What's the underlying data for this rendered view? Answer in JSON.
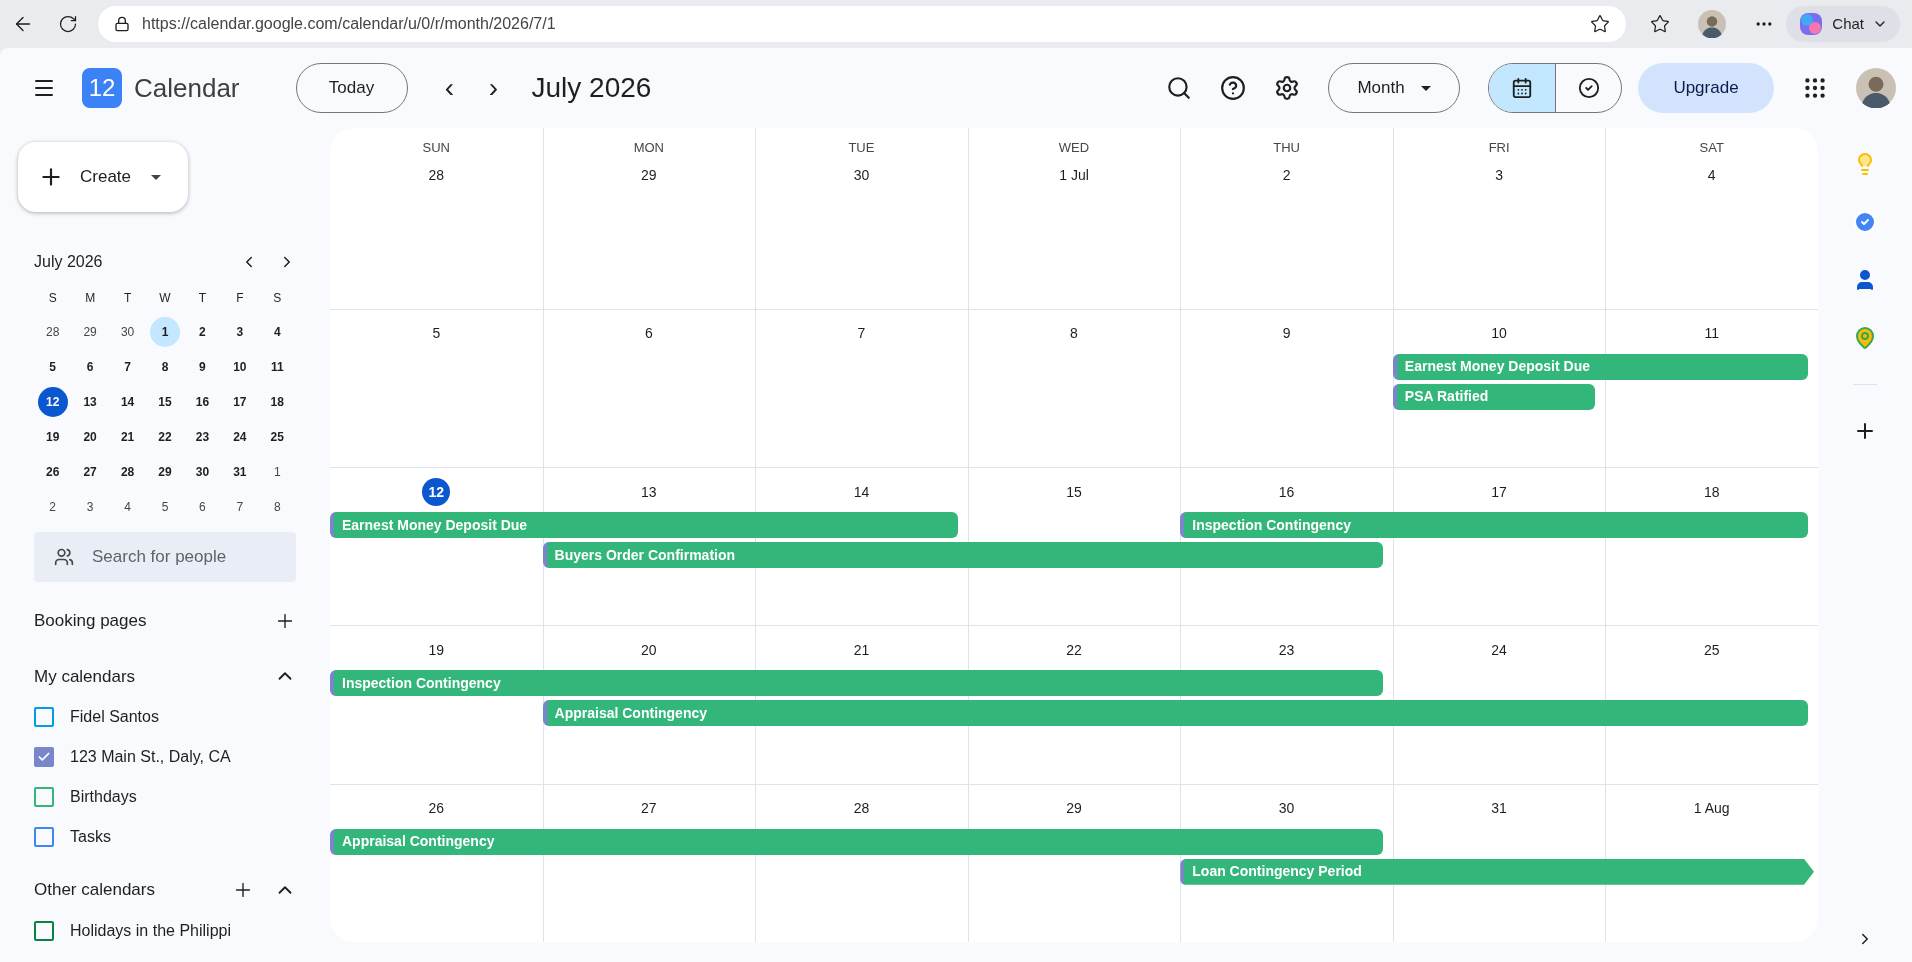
{
  "browser": {
    "url": "https://calendar.google.com/calendar/u/0/r/month/2026/7/1",
    "chat_label": "Chat"
  },
  "header": {
    "logo_day": "12",
    "app_name": "Calendar",
    "today_button": "Today",
    "prev_icon": "‹",
    "next_icon": "›",
    "title": "July 2026",
    "view_dropdown": "Month",
    "view_toggle": [
      {
        "kind": "calendar",
        "selected": true
      },
      {
        "kind": "tasks",
        "selected": false
      }
    ],
    "upgrade_button": "Upgrade"
  },
  "sidebar": {
    "create_button": "Create",
    "mini_calendar": {
      "title": "July 2026",
      "weekdays": [
        "S",
        "M",
        "T",
        "W",
        "T",
        "F",
        "S"
      ],
      "weeks": [
        [
          {
            "d": "28",
            "muted": true,
            "today": false,
            "selected": false
          },
          {
            "d": "29",
            "muted": true,
            "today": false,
            "selected": false
          },
          {
            "d": "30",
            "muted": true,
            "today": false,
            "selected": false
          },
          {
            "d": "1",
            "muted": false,
            "today": false,
            "selected": true
          },
          {
            "d": "2",
            "muted": false,
            "today": false,
            "selected": false
          },
          {
            "d": "3",
            "muted": false,
            "today": false,
            "selected": false
          },
          {
            "d": "4",
            "muted": false,
            "today": false,
            "selected": false
          }
        ],
        [
          {
            "d": "5",
            "muted": false,
            "today": false,
            "selected": false
          },
          {
            "d": "6",
            "muted": false,
            "today": false,
            "selected": false
          },
          {
            "d": "7",
            "muted": false,
            "today": false,
            "selected": false
          },
          {
            "d": "8",
            "muted": false,
            "today": false,
            "selected": false
          },
          {
            "d": "9",
            "muted": false,
            "today": false,
            "selected": false
          },
          {
            "d": "10",
            "muted": false,
            "today": false,
            "selected": false
          },
          {
            "d": "11",
            "muted": false,
            "today": false,
            "selected": false
          }
        ],
        [
          {
            "d": "12",
            "muted": false,
            "today": true,
            "selected": false
          },
          {
            "d": "13",
            "muted": false,
            "today": false,
            "selected": false
          },
          {
            "d": "14",
            "muted": false,
            "today": false,
            "selected": false
          },
          {
            "d": "15",
            "muted": false,
            "today": false,
            "selected": false
          },
          {
            "d": "16",
            "muted": false,
            "today": false,
            "selected": false
          },
          {
            "d": "17",
            "muted": false,
            "today": false,
            "selected": false
          },
          {
            "d": "18",
            "muted": false,
            "today": false,
            "selected": false
          }
        ],
        [
          {
            "d": "19",
            "muted": false,
            "today": false,
            "selected": false
          },
          {
            "d": "20",
            "muted": false,
            "today": false,
            "selected": false
          },
          {
            "d": "21",
            "muted": false,
            "today": false,
            "selected": false
          },
          {
            "d": "22",
            "muted": false,
            "today": false,
            "selected": false
          },
          {
            "d": "23",
            "muted": false,
            "today": false,
            "selected": false
          },
          {
            "d": "24",
            "muted": false,
            "today": false,
            "selected": false
          },
          {
            "d": "25",
            "muted": false,
            "today": false,
            "selected": false
          }
        ],
        [
          {
            "d": "26",
            "muted": false,
            "today": false,
            "selected": false
          },
          {
            "d": "27",
            "muted": false,
            "today": false,
            "selected": false
          },
          {
            "d": "28",
            "muted": false,
            "today": false,
            "selected": false
          },
          {
            "d": "29",
            "muted": false,
            "today": false,
            "selected": false
          },
          {
            "d": "30",
            "muted": false,
            "today": false,
            "selected": false
          },
          {
            "d": "31",
            "muted": false,
            "today": false,
            "selected": false
          },
          {
            "d": "1",
            "muted": true,
            "today": false,
            "selected": false
          }
        ],
        [
          {
            "d": "2",
            "muted": true,
            "today": false,
            "selected": false
          },
          {
            "d": "3",
            "muted": true,
            "today": false,
            "selected": false
          },
          {
            "d": "4",
            "muted": true,
            "today": false,
            "selected": false
          },
          {
            "d": "5",
            "muted": true,
            "today": false,
            "selected": false
          },
          {
            "d": "6",
            "muted": true,
            "today": false,
            "selected": false
          },
          {
            "d": "7",
            "muted": true,
            "today": false,
            "selected": false
          },
          {
            "d": "8",
            "muted": true,
            "today": false,
            "selected": false
          }
        ]
      ]
    },
    "search_placeholder": "Search for people",
    "booking_pages": "Booking pages",
    "my_calendars": {
      "title": "My calendars",
      "expanded": true,
      "items": [
        {
          "label": "Fidel Santos",
          "checked": false,
          "color": "#039be5"
        },
        {
          "label": "123 Main St., Daly, CA",
          "checked": true,
          "color": "#7986cb"
        },
        {
          "label": "Birthdays",
          "checked": false,
          "color": "#33b679"
        },
        {
          "label": "Tasks",
          "checked": false,
          "color": "#4285f4"
        }
      ]
    },
    "other_calendars": {
      "title": "Other calendars",
      "expanded": true,
      "items": [
        {
          "label": "Holidays in the Philippi",
          "checked": false,
          "color": "#0b8043"
        }
      ]
    }
  },
  "month": {
    "weekdays": [
      "SUN",
      "MON",
      "TUE",
      "WED",
      "THU",
      "FRI",
      "SAT"
    ],
    "weeks": [
      {
        "days": [
          {
            "d": "28",
            "today": false
          },
          {
            "d": "29",
            "today": false
          },
          {
            "d": "30",
            "today": false
          },
          {
            "d": "1 Jul",
            "today": false
          },
          {
            "d": "2",
            "today": false
          },
          {
            "d": "3",
            "today": false
          },
          {
            "d": "4",
            "today": false
          }
        ]
      },
      {
        "days": [
          {
            "d": "5",
            "today": false
          },
          {
            "d": "6",
            "today": false
          },
          {
            "d": "7",
            "today": false
          },
          {
            "d": "8",
            "today": false
          },
          {
            "d": "9",
            "today": false
          },
          {
            "d": "10",
            "today": false
          },
          {
            "d": "11",
            "today": false
          }
        ],
        "events": [
          {
            "title": "Earnest Money Deposit Due",
            "continues": false
          },
          {
            "title": "PSA Ratified",
            "continues": false
          }
        ]
      },
      {
        "days": [
          {
            "d": "12",
            "today": true
          },
          {
            "d": "13",
            "today": false
          },
          {
            "d": "14",
            "today": false
          },
          {
            "d": "15",
            "today": false
          },
          {
            "d": "16",
            "today": false
          },
          {
            "d": "17",
            "today": false
          },
          {
            "d": "18",
            "today": false
          }
        ],
        "events": [
          {
            "title": "Earnest Money Deposit Due",
            "continues": false
          },
          {
            "title": "Inspection Contingency",
            "continues": false
          },
          {
            "title": "Buyers Order Confirmation",
            "continues": false
          }
        ]
      },
      {
        "days": [
          {
            "d": "19",
            "today": false
          },
          {
            "d": "20",
            "today": false
          },
          {
            "d": "21",
            "today": false
          },
          {
            "d": "22",
            "today": false
          },
          {
            "d": "23",
            "today": false
          },
          {
            "d": "24",
            "today": false
          },
          {
            "d": "25",
            "today": false
          }
        ],
        "events": [
          {
            "title": "Inspection Contingency",
            "continues": false
          },
          {
            "title": "Appraisal Contingency",
            "continues": false
          }
        ]
      },
      {
        "days": [
          {
            "d": "26",
            "today": false
          },
          {
            "d": "27",
            "today": false
          },
          {
            "d": "28",
            "today": false
          },
          {
            "d": "29",
            "today": false
          },
          {
            "d": "30",
            "today": false
          },
          {
            "d": "31",
            "today": false
          },
          {
            "d": "1 Aug",
            "today": false
          }
        ],
        "events": [
          {
            "title": "Appraisal Contingency",
            "continues": false
          },
          {
            "title": "Loan Contingency Period",
            "continues": true
          }
        ]
      }
    ]
  }
}
